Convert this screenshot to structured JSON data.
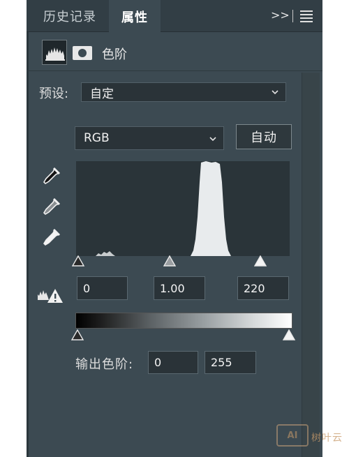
{
  "tabs": {
    "history": "历史记录",
    "properties": "属性",
    "expand_glyph": ">>"
  },
  "properties": {
    "title": "色阶",
    "preset_label": "预设:",
    "preset_value": "自定",
    "channel_value": "RGB",
    "auto_label": "自动"
  },
  "input_levels": {
    "black": "0",
    "gamma": "1.00",
    "white": "220"
  },
  "output_levels": {
    "label": "输出色阶:",
    "black": "0",
    "white": "255"
  },
  "watermark": {
    "badge": "AI",
    "text": "树叶云"
  },
  "colors": {
    "panel_bg": "#3c4a52",
    "histogram_bg": "#2a3439",
    "histogram_fill": "#e8ebed",
    "watermark": "#c89a6a"
  },
  "icons": [
    "levels-icon",
    "mask-icon",
    "black-eyedropper-icon",
    "gray-eyedropper-icon",
    "white-eyedropper-icon",
    "clip-warning-icon",
    "chevron-down-icon",
    "panel-menu-icon"
  ]
}
